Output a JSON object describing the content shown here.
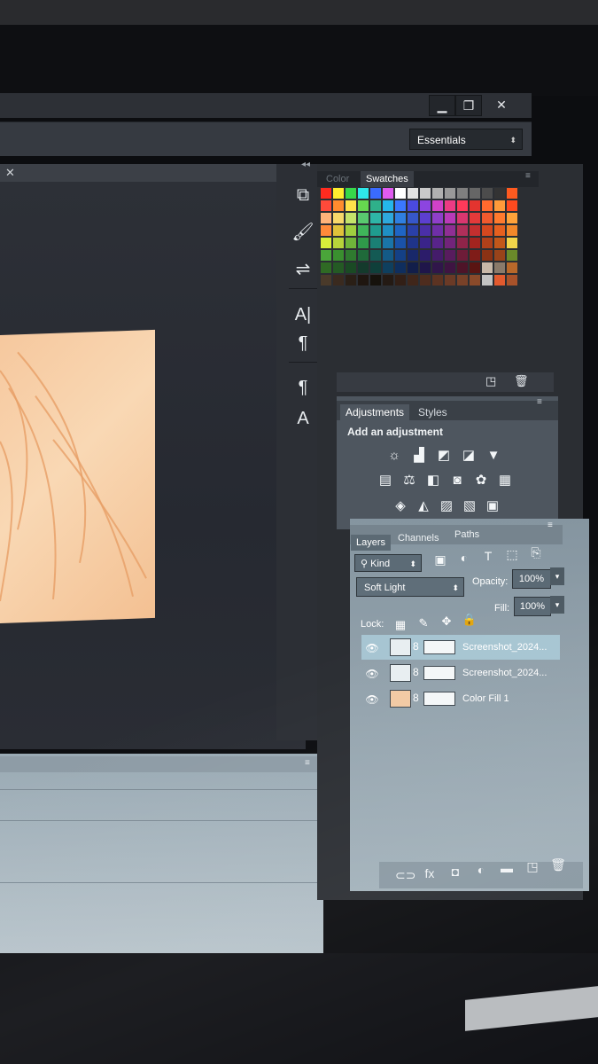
{
  "window": {
    "minimize_icon": "minimize-icon",
    "restore_icon": "restore-icon",
    "close_icon": "close-icon",
    "minimize_glyph": "▁",
    "restore_glyph": "❐",
    "close_glyph": "✕"
  },
  "options_bar": {
    "workspace": "Essentials",
    "workspace_arrow": "⬍"
  },
  "document": {
    "close_glyph": "✕",
    "canvas_fill_colors": [
      "#f6c89e",
      "#f9d8b4",
      "#f3c092"
    ]
  },
  "tool_strip": {
    "collapse_glyph": "◂◂",
    "tools": [
      {
        "name": "history-icon",
        "glyph": "⧉"
      },
      {
        "name": "brush-presets-icon",
        "glyph": "🖌"
      },
      {
        "name": "clone-source-icon",
        "glyph": "⇌"
      },
      {
        "name": "character-icon",
        "glyph": "A|"
      },
      {
        "name": "paragraph-icon",
        "glyph": "¶"
      },
      {
        "name": "paragraph-styles-icon",
        "glyph": "¶"
      },
      {
        "name": "character-styles-icon",
        "glyph": "A"
      }
    ]
  },
  "swatches_panel": {
    "tabs": [
      "Color",
      "Swatches"
    ],
    "active_tab": "Swatches",
    "menu_glyph": "≡",
    "new_swatch_icon": "new-swatch-icon",
    "delete_icon": "trash-icon",
    "new_swatch_glyph": "◳",
    "delete_glyph": "🗑",
    "rows": [
      [
        "#ff2b1f",
        "#ffee2e",
        "#37d84a",
        "#2ee8ea",
        "#3a6bff",
        "#e05bf0",
        "#ffffff",
        "#e3e3e3",
        "#c9c9c9",
        "#b0b0b0",
        "#999999",
        "#7f7f7f",
        "#666666",
        "#4c4c4c",
        "#333333",
        "#ff5a1f"
      ],
      [
        "#ff4a3a",
        "#ff8b2e",
        "#ffe14a",
        "#66d84f",
        "#2fb08a",
        "#25b7ea",
        "#3a78ff",
        "#4a4adf",
        "#8c45e0",
        "#d042c9",
        "#ec3b84",
        "#ff3a5a",
        "#e3342f",
        "#ff6a2e",
        "#ff9a3a",
        "#ff4a1f"
      ],
      [
        "#ffb37a",
        "#f7d86a",
        "#c4e36a",
        "#59c96f",
        "#2eb5a7",
        "#2ea9dc",
        "#2f7fe0",
        "#3657c9",
        "#5c3fcf",
        "#8f3fc9",
        "#b93ab8",
        "#d9376f",
        "#e33a3a",
        "#ef5a2e",
        "#ff7a2e",
        "#ffa23a"
      ],
      [
        "#ff8a3a",
        "#e0c23a",
        "#9fcf3f",
        "#3fb55a",
        "#1f9c8f",
        "#1f8fc4",
        "#1f65c4",
        "#2a40a8",
        "#4a2fa8",
        "#6f2fa8",
        "#8f2f94",
        "#b02f5a",
        "#c42f2f",
        "#d4481f",
        "#e6601f",
        "#f2882a"
      ],
      [
        "#d8ee3a",
        "#b8d43a",
        "#6fb53a",
        "#2f9a4a",
        "#1a7f74",
        "#1a75a8",
        "#1a52a8",
        "#1f348a",
        "#3a248a",
        "#58248a",
        "#72247a",
        "#8f2449",
        "#a3241f",
        "#b0401a",
        "#c2571a",
        "#f2d44a"
      ],
      [
        "#4aa53a",
        "#3a8f2f",
        "#2f7a2f",
        "#1f6a3a",
        "#145a54",
        "#145a86",
        "#144086",
        "#18286a",
        "#2c1c6a",
        "#441c6a",
        "#581c5e",
        "#6e1c38",
        "#7f1c18",
        "#8a3214",
        "#98431a",
        "#6a8a2a"
      ],
      [
        "#2f6a24",
        "#245a24",
        "#1a4a24",
        "#143a2c",
        "#0f3f3a",
        "#0f3f5e",
        "#0f2e5e",
        "#121e4a",
        "#1f164a",
        "#30164a",
        "#3e1442",
        "#4e1428",
        "#5a1412",
        "#c8b8a8",
        "#8a7a6a",
        "#b8682a"
      ],
      [
        "#4a3a2a",
        "#3a2a1f",
        "#2a1f16",
        "#1f1610",
        "#16120c",
        "#241a14",
        "#321f16",
        "#40261a",
        "#4e2c1e",
        "#5c3322",
        "#6a3a26",
        "#784128",
        "#8a4a2a",
        "#c2c2c2",
        "#e25a2e",
        "#a8522a"
      ]
    ]
  },
  "adjustments_panel": {
    "tabs": [
      "Adjustments",
      "Styles"
    ],
    "active_tab": "Adjustments",
    "title": "Add an adjustment",
    "menu_glyph": "≡",
    "row1": [
      {
        "name": "brightness-contrast-icon",
        "glyph": "☼"
      },
      {
        "name": "levels-icon",
        "glyph": "▟"
      },
      {
        "name": "curves-icon",
        "glyph": "◩"
      },
      {
        "name": "exposure-icon",
        "glyph": "◪"
      },
      {
        "name": "vibrance-icon",
        "glyph": "▼"
      }
    ],
    "row2": [
      {
        "name": "hue-saturation-icon",
        "glyph": "▤"
      },
      {
        "name": "color-balance-icon",
        "glyph": "⚖"
      },
      {
        "name": "black-white-icon",
        "glyph": "◧"
      },
      {
        "name": "photo-filter-icon",
        "glyph": "◙"
      },
      {
        "name": "channel-mixer-icon",
        "glyph": "✿"
      },
      {
        "name": "color-lookup-icon",
        "glyph": "▦"
      }
    ],
    "row3": [
      {
        "name": "invert-icon",
        "glyph": "◈"
      },
      {
        "name": "posterize-icon",
        "glyph": "◭"
      },
      {
        "name": "threshold-icon",
        "glyph": "▨"
      },
      {
        "name": "gradient-map-icon",
        "glyph": "▧"
      },
      {
        "name": "selective-color-icon",
        "glyph": "▣"
      }
    ]
  },
  "layers_panel": {
    "tabs": [
      "Layers",
      "Channels",
      "Paths"
    ],
    "active_tab": "Layers",
    "menu_glyph": "≡",
    "kind_filter": "⚲ Kind",
    "kind_arrow": "⬍",
    "filter_icons": [
      {
        "name": "pixel-filter-icon",
        "glyph": "▣"
      },
      {
        "name": "adjustment-filter-icon",
        "glyph": "◐"
      },
      {
        "name": "type-filter-icon",
        "glyph": "T"
      },
      {
        "name": "shape-filter-icon",
        "glyph": "⬚"
      },
      {
        "name": "smart-object-filter-icon",
        "glyph": "⎘"
      }
    ],
    "blend_mode": "Soft Light",
    "blend_arrow": "⬍",
    "opacity_label": "Opacity:",
    "opacity_value": "100%",
    "fill_label": "Fill:",
    "fill_value": "100%",
    "dropdown_arrow": "▾",
    "lock_label": "Lock:",
    "lock_icons": [
      {
        "name": "lock-transparent-icon",
        "glyph": "▦"
      },
      {
        "name": "lock-image-icon",
        "glyph": "✎"
      },
      {
        "name": "lock-position-icon",
        "glyph": "✥"
      },
      {
        "name": "lock-all-icon",
        "glyph": "🔒"
      }
    ],
    "layers": [
      {
        "name": "Screenshot_2024...",
        "selected": true,
        "thumb": "#e8eef1",
        "mask": "#f4f7f8"
      },
      {
        "name": "Screenshot_2024...",
        "selected": false,
        "thumb": "#e8eef1",
        "mask": "#f4f7f8"
      },
      {
        "name": "Color Fill 1",
        "selected": false,
        "thumb": "#f2c9a4",
        "mask": "#f4f7f8"
      }
    ],
    "eye_glyph": "👁",
    "link_glyph": "8",
    "footer_icons": [
      {
        "name": "link-layers-icon",
        "glyph": "⊂⊃"
      },
      {
        "name": "fx-icon",
        "glyph": "fx"
      },
      {
        "name": "add-mask-icon",
        "glyph": "◘"
      },
      {
        "name": "new-adjustment-icon",
        "glyph": "◐"
      },
      {
        "name": "new-group-icon",
        "glyph": "▬"
      },
      {
        "name": "new-layer-icon",
        "glyph": "◳"
      },
      {
        "name": "delete-layer-icon",
        "glyph": "🗑"
      }
    ]
  }
}
